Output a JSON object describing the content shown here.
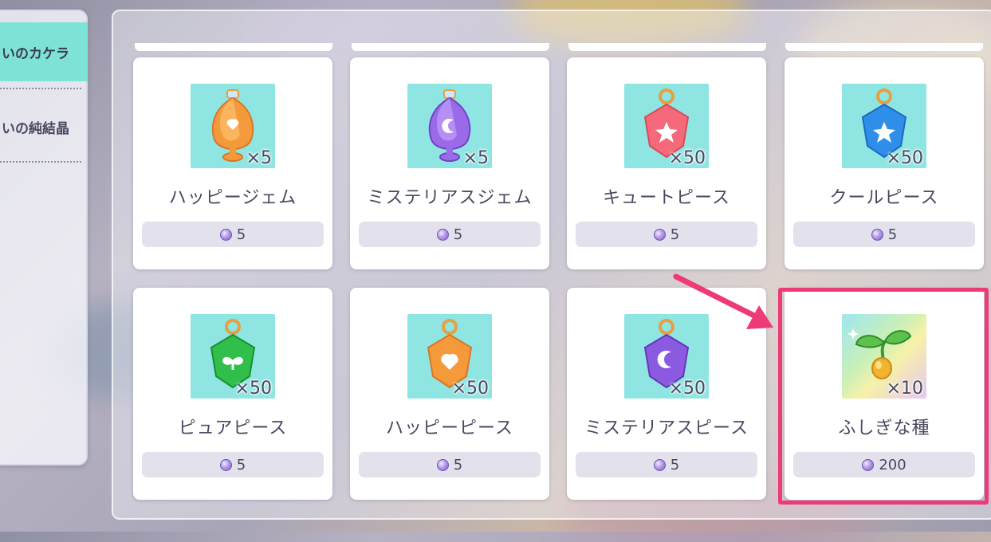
{
  "sidebar": {
    "tabs": [
      {
        "label": "いのカケラ",
        "active": true
      },
      {
        "label": "いの純結晶",
        "active": false
      }
    ]
  },
  "shop": {
    "currency_icon": "purple-gem-icon",
    "items": [
      {
        "name": "ハッピージェム",
        "quantity": "×5",
        "price": "5",
        "icon": "happy-gem-bottle-icon",
        "color": "#f59a3a"
      },
      {
        "name": "ミステリアスジェム",
        "quantity": "×5",
        "price": "5",
        "icon": "mysterious-gem-bottle-icon",
        "color": "#9a6ae8"
      },
      {
        "name": "キュートピース",
        "quantity": "×50",
        "price": "5",
        "icon": "cute-piece-star-icon",
        "color": "#f56a7a"
      },
      {
        "name": "クールピース",
        "quantity": "×50",
        "price": "5",
        "icon": "cool-piece-star-icon",
        "color": "#2f8fe8"
      },
      {
        "name": "ピュアピース",
        "quantity": "×50",
        "price": "5",
        "icon": "pure-piece-sprout-icon",
        "color": "#2fbf4a"
      },
      {
        "name": "ハッピーピース",
        "quantity": "×50",
        "price": "5",
        "icon": "happy-piece-heart-icon",
        "color": "#f59a3a"
      },
      {
        "name": "ミステリアスピース",
        "quantity": "×50",
        "price": "5",
        "icon": "mysterious-piece-moon-icon",
        "color": "#8a5ae0"
      },
      {
        "name": "ふしぎな種",
        "quantity": "×10",
        "price": "200",
        "icon": "mysterious-seed-icon",
        "color": "#5cc24a",
        "highlighted": true
      }
    ]
  }
}
